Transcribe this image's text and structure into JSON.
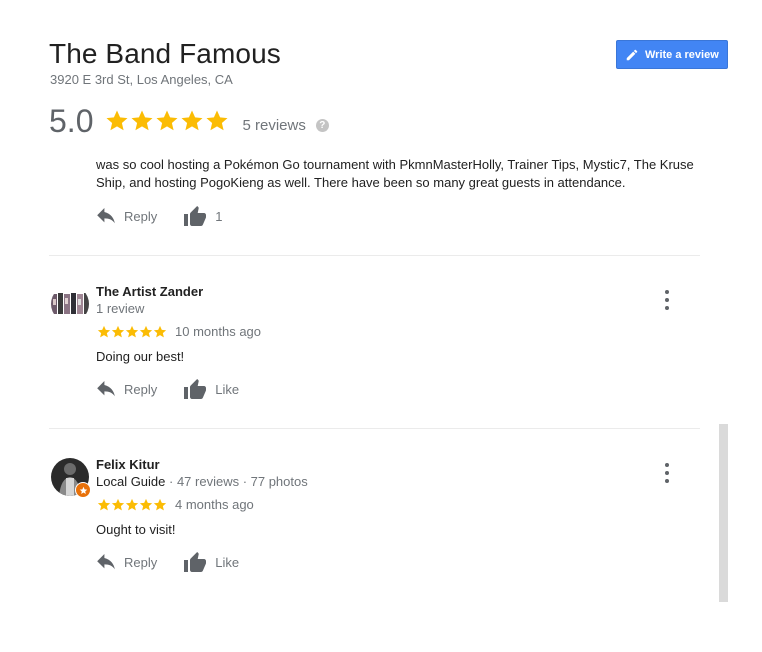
{
  "business": {
    "name": "The Band Famous",
    "address": "3920 E 3rd St, Los Angeles, CA",
    "rating": "5.0",
    "rating_stars": 5,
    "review_count": "5 reviews",
    "help_glyph": "?"
  },
  "write_review": {
    "label": "Write a review",
    "icon": "pencil-icon",
    "color": "#4285f4"
  },
  "star_color": "#fbbc04",
  "reviews": [
    {
      "text": "was so cool hosting a Pokémon Go tournament with PkmnMasterHolly, Trainer Tips, Mystic7, The Kruse Ship, and hosting PogoKieng as well. There have been so many great guests in attendance.",
      "reply_label": "Reply",
      "like_label": "1"
    },
    {
      "name": "The Artist Zander",
      "meta": "1 review",
      "stars": 5,
      "date": "10 months ago",
      "text": "Doing our best!",
      "reply_label": "Reply",
      "like_label": "Like"
    },
    {
      "name": "Felix Kitur",
      "local_guide": "Local Guide",
      "meta": " · 47 reviews · 77 photos",
      "stars": 5,
      "date": "4 months ago",
      "text": "Ought to visit!",
      "reply_label": "Reply",
      "like_label": "Like",
      "badge_color": "#e8710a"
    }
  ]
}
